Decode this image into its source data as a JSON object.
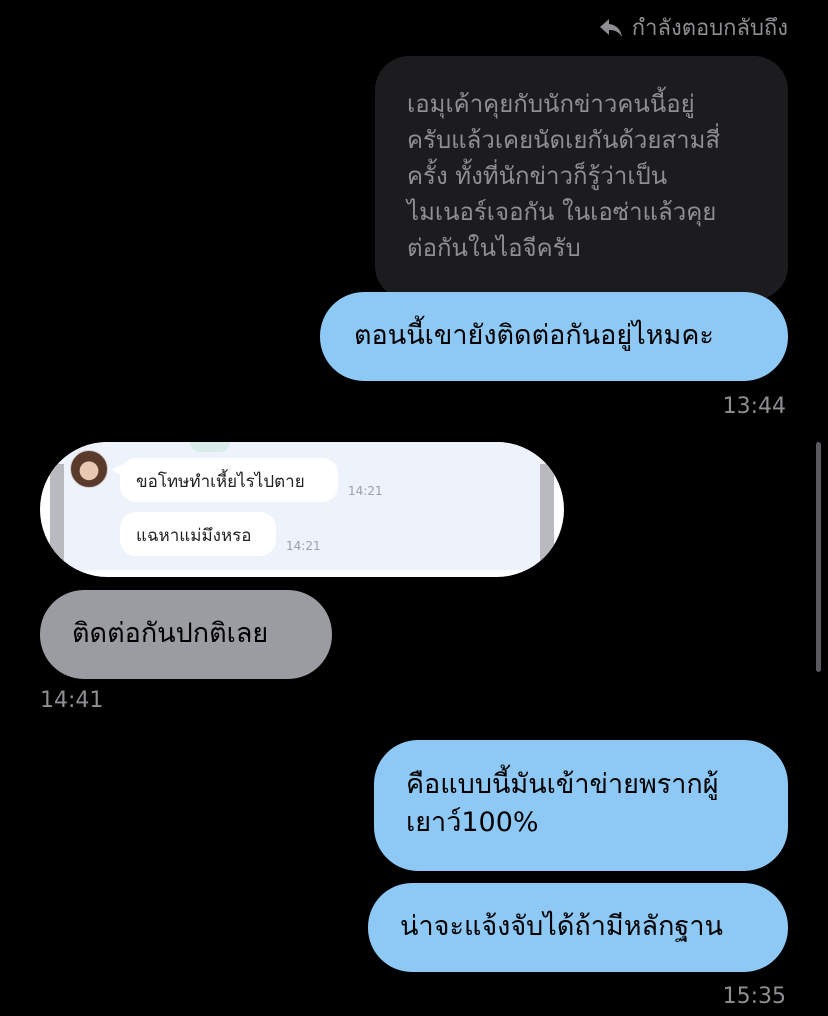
{
  "reply_header": {
    "label": "กำลังตอบกลับถึง"
  },
  "quoted_message": {
    "lines": [
      "เอมุเค้าคุยกับนักข่าวคนนี้อยู่",
      "ครับแล้วเคยนัดเยกันด้วยสามสี่",
      "ครั้ง ทั้งที่นักข่าวก็รู้ว่าเป็น",
      "ไมเนอร์เจอกัน ในเอซ่าแล้วคุย",
      "ต่อกันในไอจีครับ"
    ]
  },
  "messages": [
    {
      "id": "m1",
      "side": "outgoing",
      "lines": [
        "ตอนนี้เขายังติดต่อกันอยู่ไหมคะ"
      ],
      "time": "13:44"
    },
    {
      "id": "attachment",
      "side": "incoming",
      "screenshot": {
        "bubbles": [
          {
            "text": "ขอโทษทำเหี้ยไรไปตาย",
            "time": "14:21"
          },
          {
            "text": "แฉหาแม่มึงหรอ",
            "time": "14:21"
          }
        ]
      }
    },
    {
      "id": "m2",
      "side": "incoming",
      "lines": [
        "ติดต่อกันปกติเลย"
      ],
      "time": "14:41"
    },
    {
      "id": "m3",
      "side": "outgoing",
      "lines": [
        "คือแบบนี้มันเข้าข่ายพรากผู้",
        "เยาว์100%"
      ]
    },
    {
      "id": "m4",
      "side": "outgoing",
      "lines": [
        "น่าจะแจ้งจับได้ถ้ามีหลักฐาน"
      ],
      "time": "15:35"
    }
  ],
  "colors": {
    "background": "#000000",
    "outgoing_bubble": "#8ec9f6",
    "incoming_bubble": "#9a9ca1",
    "quoted_bubble": "#1c1c1e",
    "meta_text": "#8e8e93"
  },
  "icons": {
    "reply": "reply-arrow-icon"
  }
}
